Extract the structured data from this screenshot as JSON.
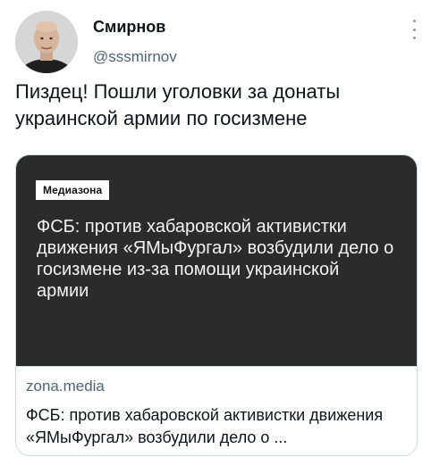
{
  "user": {
    "name": "Смирнов",
    "handle": "@sssmirnov"
  },
  "tweet": {
    "text": "Пиздец! Пошли уголовки за донаты\nукраинской армии по госизмене"
  },
  "card": {
    "media_logo": "Медиазона",
    "media_headline": "ФСБ: против хабаровской активистки движения «ЯМыФургал» возбудили дело о госизмене из-за помощи украинской армии",
    "domain": "zona.media",
    "title": "ФСБ: против хабаровской активистки движения «ЯМыФургал» возбудили дело о ..."
  },
  "colors": {
    "media_background": "#2b2b2b",
    "secondary_text": "#536471",
    "card_border": "#cfd9de"
  },
  "icons": {
    "more": "more-vertical-icon"
  }
}
